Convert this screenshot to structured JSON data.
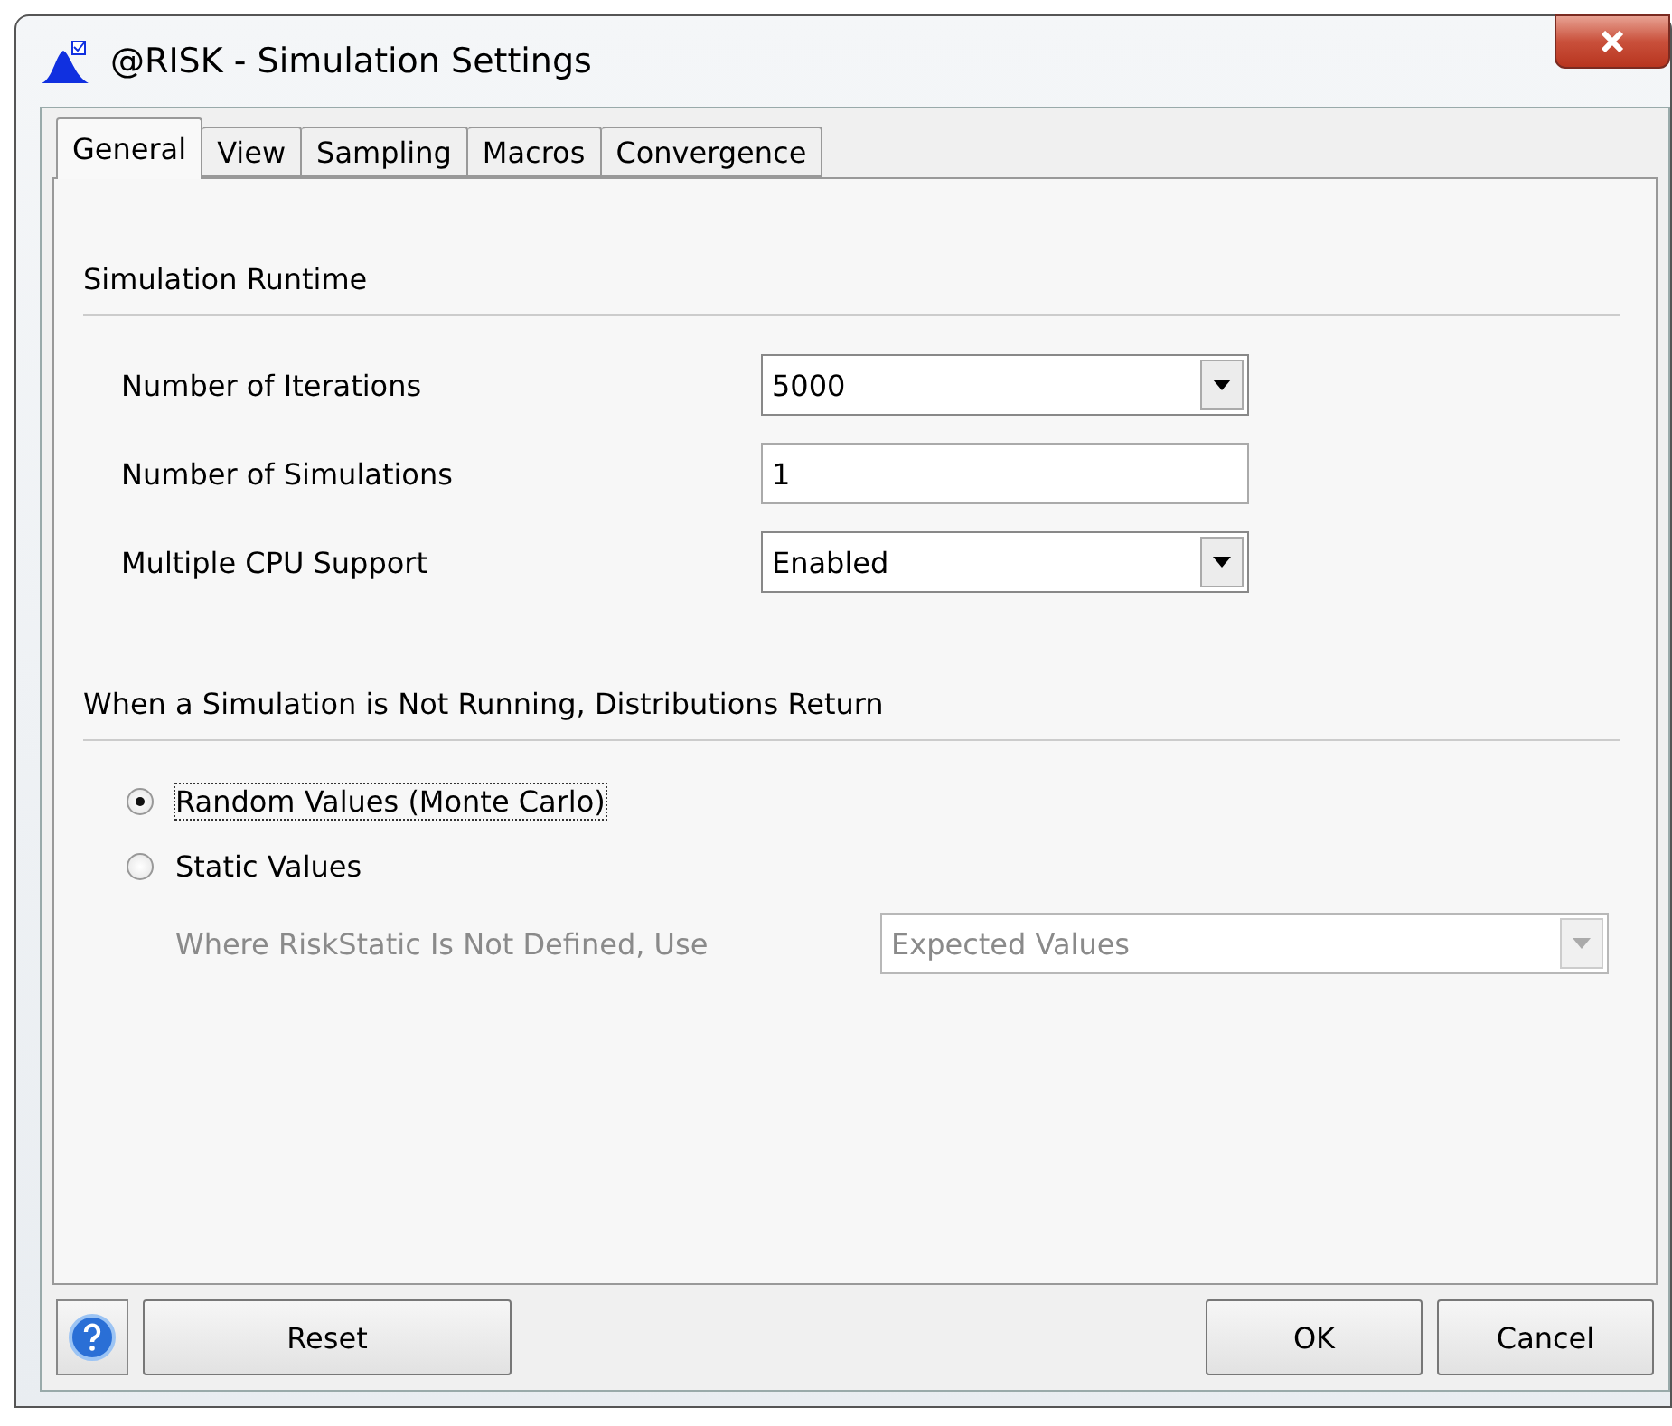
{
  "window": {
    "title": "@RISK - Simulation Settings"
  },
  "tabs": [
    {
      "label": "General",
      "selected": true
    },
    {
      "label": "View",
      "selected": false
    },
    {
      "label": "Sampling",
      "selected": false
    },
    {
      "label": "Macros",
      "selected": false
    },
    {
      "label": "Convergence",
      "selected": false
    }
  ],
  "runtime": {
    "heading": "Simulation Runtime",
    "fields": [
      {
        "label": "Number of Iterations",
        "kind": "dropdown",
        "value": "5000"
      },
      {
        "label": "Number of Simulations",
        "kind": "text",
        "value": "1"
      },
      {
        "label": "Multiple CPU Support",
        "kind": "dropdown",
        "value": "Enabled"
      }
    ]
  },
  "distributions": {
    "heading": "When a Simulation is Not Running, Distributions Return",
    "options": [
      {
        "label": "Random Values (Monte Carlo)",
        "selected": true
      },
      {
        "label": "Static Values",
        "selected": false
      }
    ],
    "static_option": {
      "label": "Where RiskStatic Is Not Defined, Use",
      "value": "Expected Values",
      "disabled": true
    }
  },
  "buttons": {
    "reset": "Reset",
    "ok": "OK",
    "cancel": "Cancel"
  }
}
